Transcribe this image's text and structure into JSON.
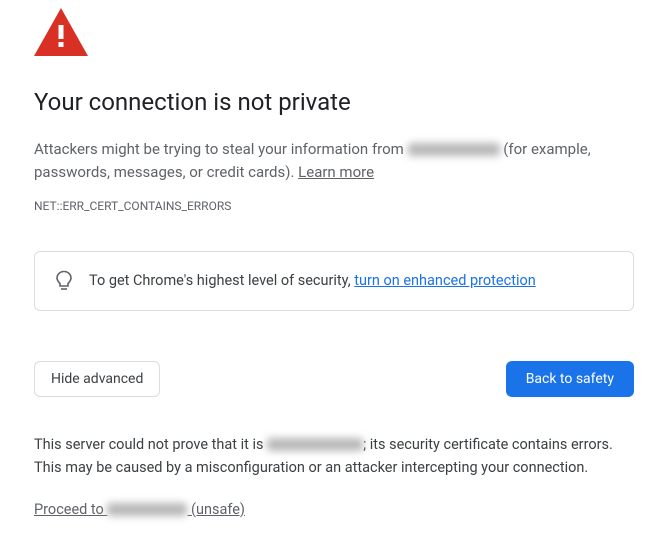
{
  "title": "Your connection is not private",
  "description": {
    "prefix": "Attackers might be trying to steal your information from ",
    "suffix": " (for example, passwords, messages, or credit cards). ",
    "learn_more": "Learn more"
  },
  "error_code": "NET::ERR_CERT_CONTAINS_ERRORS",
  "enhanced": {
    "prefix": "To get Chrome's highest level of security, ",
    "link": "turn on enhanced protection"
  },
  "buttons": {
    "advanced": "Hide advanced",
    "safety": "Back to safety"
  },
  "advanced_details": {
    "prefix": "This server could not prove that it is ",
    "suffix": "; its security certificate contains errors. This may be caused by a misconfiguration or an attacker intercepting your connection."
  },
  "proceed": {
    "prefix": "Proceed to ",
    "suffix": " (unsafe)"
  }
}
